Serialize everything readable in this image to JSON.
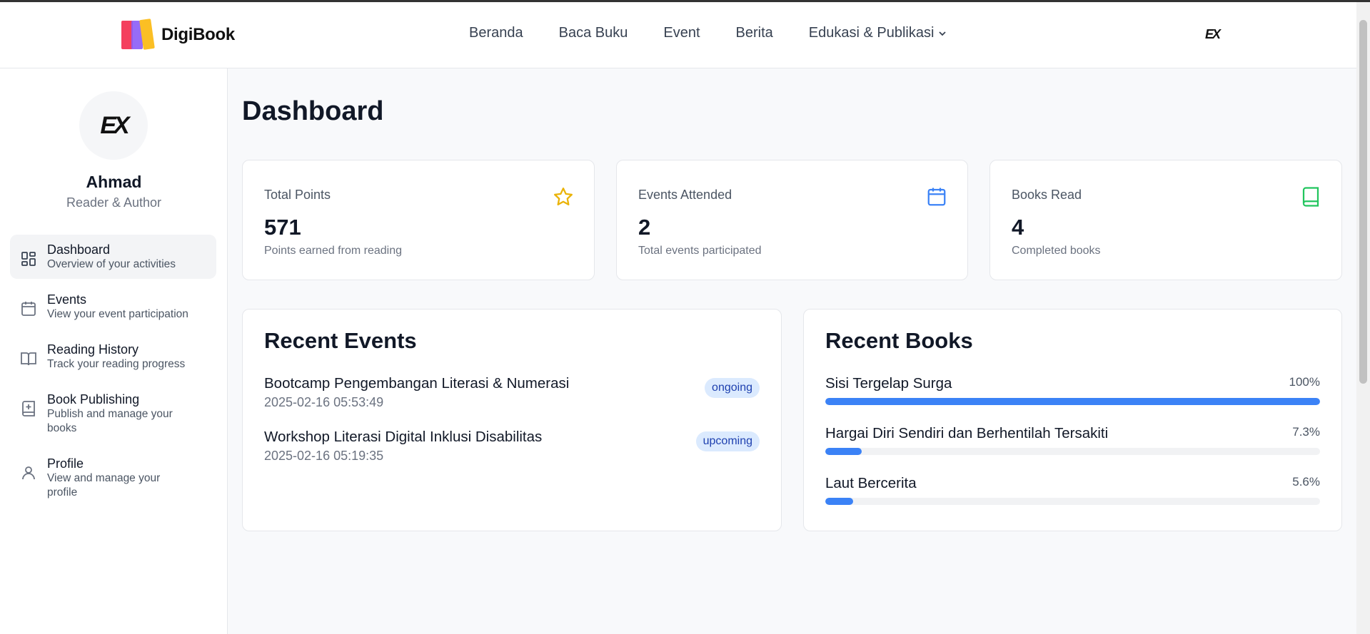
{
  "header": {
    "brand": "DigiBook",
    "menu": [
      "Beranda",
      "Baca Buku",
      "Event",
      "Berita",
      "Edukasi & Publikasi"
    ],
    "avatar_text": "EX"
  },
  "sidebar": {
    "avatar_text": "EX",
    "user_name": "Ahmad",
    "user_role": "Reader & Author",
    "items": [
      {
        "title": "Dashboard",
        "subtitle": "Overview of your activities",
        "icon": "grid-icon"
      },
      {
        "title": "Events",
        "subtitle": "View your event participation",
        "icon": "calendar-icon"
      },
      {
        "title": "Reading History",
        "subtitle": "Track your reading progress",
        "icon": "book-open-icon"
      },
      {
        "title": "Book Publishing",
        "subtitle": "Publish and manage your books",
        "icon": "book-plus-icon"
      },
      {
        "title": "Profile",
        "subtitle": "View and manage your profile",
        "icon": "user-icon"
      }
    ]
  },
  "main": {
    "title": "Dashboard",
    "stats": [
      {
        "label": "Total Points",
        "value": "571",
        "sub": "Points earned from reading",
        "icon": "star-icon",
        "color": "#eab308"
      },
      {
        "label": "Events Attended",
        "value": "2",
        "sub": "Total events participated",
        "icon": "calendar-icon",
        "color": "#3b82f6"
      },
      {
        "label": "Books Read",
        "value": "4",
        "sub": "Completed books",
        "icon": "book-icon",
        "color": "#22c55e"
      }
    ],
    "recent_events": {
      "title": "Recent Events",
      "items": [
        {
          "name": "Bootcamp Pengembangan Literasi & Numerasi",
          "date": "2025-02-16 05:53:49",
          "status": "ongoing"
        },
        {
          "name": "Workshop Literasi Digital Inklusi Disabilitas",
          "date": "2025-02-16 05:19:35",
          "status": "upcoming"
        }
      ]
    },
    "recent_books": {
      "title": "Recent Books",
      "items": [
        {
          "name": "Sisi Tergelap Surga",
          "progress_label": "100%",
          "progress": 100
        },
        {
          "name": "Hargai Diri Sendiri dan Berhentilah Tersakiti",
          "progress_label": "7.3%",
          "progress": 7.3
        },
        {
          "name": "Laut Bercerita",
          "progress_label": "5.6%",
          "progress": 5.6
        }
      ]
    }
  },
  "colors": {
    "accent": "#3b82f6",
    "badge_bg": "#dbeafe",
    "badge_text": "#1e40af"
  }
}
